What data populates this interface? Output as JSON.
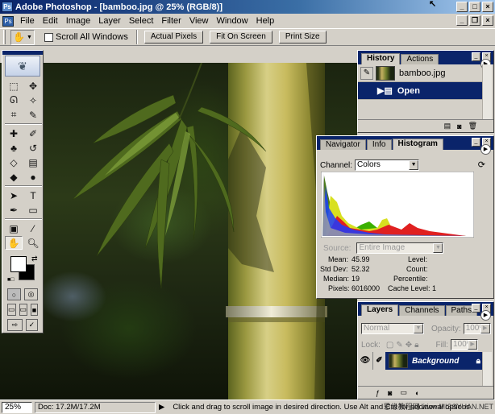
{
  "window": {
    "title": "Adobe Photoshop - [bamboo.jpg @ 25% (RGB/8)]"
  },
  "menu": [
    "File",
    "Edit",
    "Image",
    "Layer",
    "Select",
    "Filter",
    "View",
    "Window",
    "Help"
  ],
  "options_bar": {
    "scroll_all_label": "Scroll All Windows",
    "actual_pixels": "Actual Pixels",
    "fit_on_screen": "Fit On Screen",
    "print_size": "Print Size"
  },
  "history_panel": {
    "tabs": [
      "History",
      "Actions"
    ],
    "items": [
      {
        "label": "bamboo.jpg"
      },
      {
        "label": "Open"
      }
    ]
  },
  "histogram_panel": {
    "tabs": [
      "Navigator",
      "Info",
      "Histogram"
    ],
    "channel_label": "Channel:",
    "channel_value": "Colors",
    "source_label": "Source:",
    "source_value": "Entire Image",
    "stats": {
      "mean_label": "Mean:",
      "mean": "45.99",
      "std_label": "Std Dev:",
      "std": "52.32",
      "median_label": "Median:",
      "median": "19",
      "pixels_label": "Pixels:",
      "pixels": "6016000",
      "level_label": "Level:",
      "count_label": "Count:",
      "percentile_label": "Percentile:",
      "cache_label": "Cache Level:",
      "cache": "1"
    }
  },
  "layers_panel": {
    "tabs": [
      "Layers",
      "Channels",
      "Paths"
    ],
    "blend_mode": "Normal",
    "opacity_label": "Opacity:",
    "opacity": "100%",
    "lock_label": "Lock:",
    "fill_label": "Fill:",
    "fill": "100%",
    "layer_name": "Background"
  },
  "status_bar": {
    "zoom": "25%",
    "doc": "Doc: 17.2M/17.2M",
    "tip": "Click and drag to scroll image in desired direction.  Use Alt and Ctrl for additional options"
  },
  "watermark": "思缘教程网 www.MISSYUAN.NET",
  "colors": {
    "title_bar": "#0a246a",
    "selection": "#0a246a",
    "chrome": "#d4d0c8",
    "foreground_color": "#ffffff",
    "background_color": "#000000"
  }
}
